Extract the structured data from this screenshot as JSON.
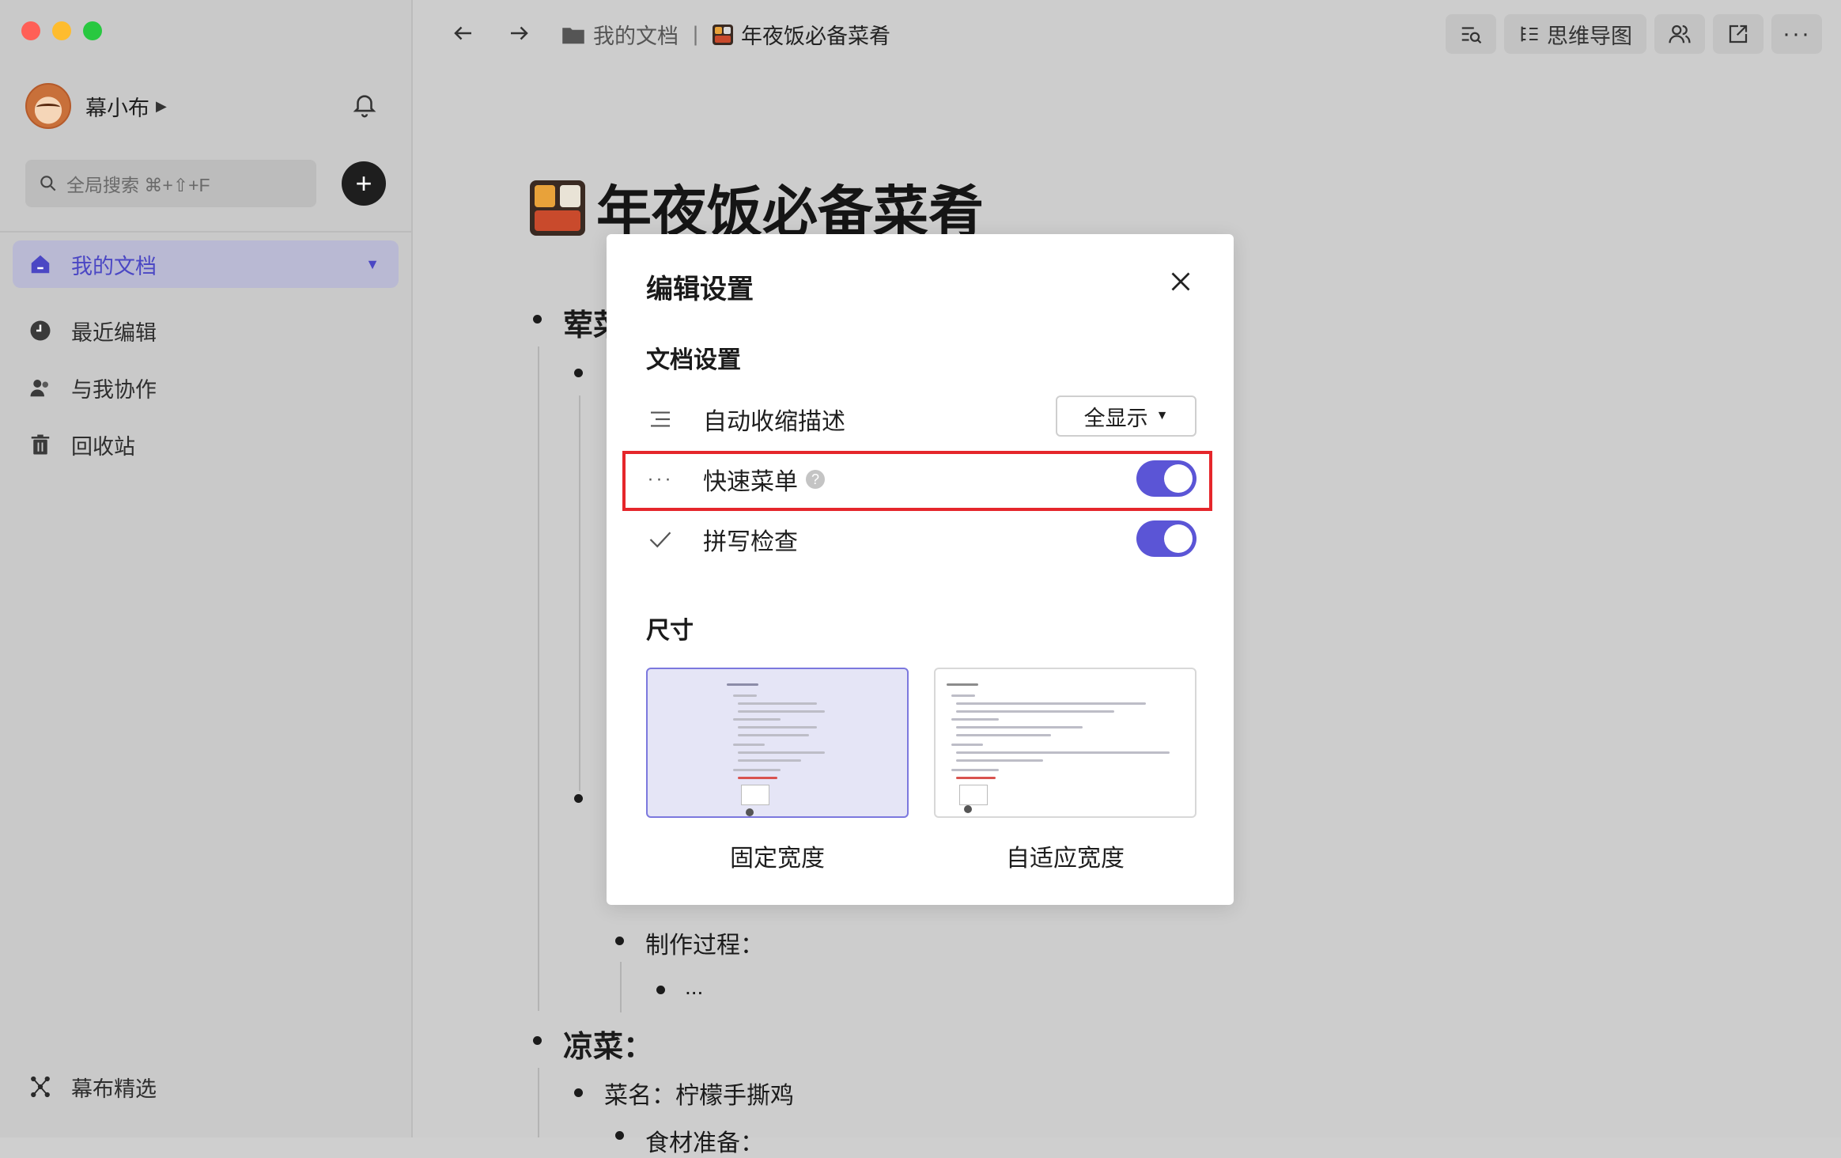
{
  "user": {
    "name": "幕小布"
  },
  "search": {
    "placeholder": "全局搜索 ⌘+⇧+F"
  },
  "sidebar": {
    "items": [
      {
        "label": "我的文档",
        "icon": "home-icon"
      },
      {
        "label": "最近编辑",
        "icon": "clock-icon"
      },
      {
        "label": "与我协作",
        "icon": "users-icon"
      },
      {
        "label": "回收站",
        "icon": "trash-icon"
      }
    ],
    "featured": {
      "label": "幕布精选",
      "icon": "mindnodes-icon"
    }
  },
  "breadcrumb": {
    "folder": "我的文档",
    "separator": "|",
    "doc": "年夜饭必备菜肴"
  },
  "toolbar": {
    "mindmap_label": "思维导图"
  },
  "document": {
    "title": "年夜饭必备菜肴",
    "h1": "荤菜",
    "step": "制作过程：",
    "ellipsis": "...",
    "h2": "凉菜：",
    "dish": "菜名：柠檬手撕鸡",
    "ingredients": "食材准备："
  },
  "modal": {
    "title": "编辑设置",
    "section_doc": "文档设置",
    "rows": [
      {
        "label": "自动收缩描述",
        "value": "全显示"
      },
      {
        "label": "快速菜单",
        "help": "?",
        "on": true
      },
      {
        "label": "拼写检查",
        "on": true
      }
    ],
    "section_size": "尺寸",
    "sizes": [
      {
        "label": "固定宽度",
        "selected": true
      },
      {
        "label": "自适应宽度",
        "selected": false
      }
    ]
  },
  "colors": {
    "accent": "#5b55d6",
    "highlight": "#e5262b"
  }
}
